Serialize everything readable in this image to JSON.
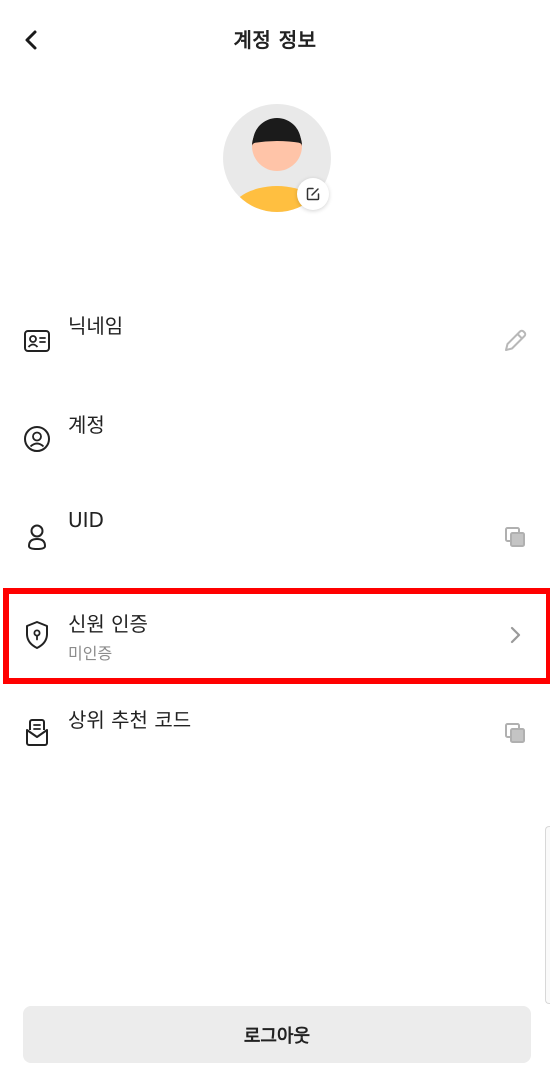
{
  "header": {
    "title": "계정 정보",
    "back_icon": "chevron-left-icon"
  },
  "avatar": {
    "edit_icon": "edit-square-icon",
    "colors": {
      "bg": "#e9e9e9",
      "hair": "#1b1b1b",
      "face": "#ffc4a8",
      "body": "#ffbf40"
    }
  },
  "rows": [
    {
      "label": "닉네임",
      "icon": "id-card-icon",
      "right_icon": "pencil-icon"
    },
    {
      "label": "계정",
      "icon": "user-circle-icon"
    },
    {
      "label": "UID",
      "icon": "user-icon",
      "right_icon": "copy-icon"
    },
    {
      "label": "신원 인증",
      "sub": "미인증",
      "icon": "shield-icon",
      "right_icon": "chevron-right-icon"
    },
    {
      "label": "상위 추천 코드",
      "icon": "letter-icon",
      "right_icon": "copy-icon"
    }
  ],
  "footer": {
    "logout_label": "로그아웃"
  },
  "colors": {
    "highlight": "#ff0000",
    "muted": "#8c8c8c",
    "button_bg": "#ececec"
  }
}
